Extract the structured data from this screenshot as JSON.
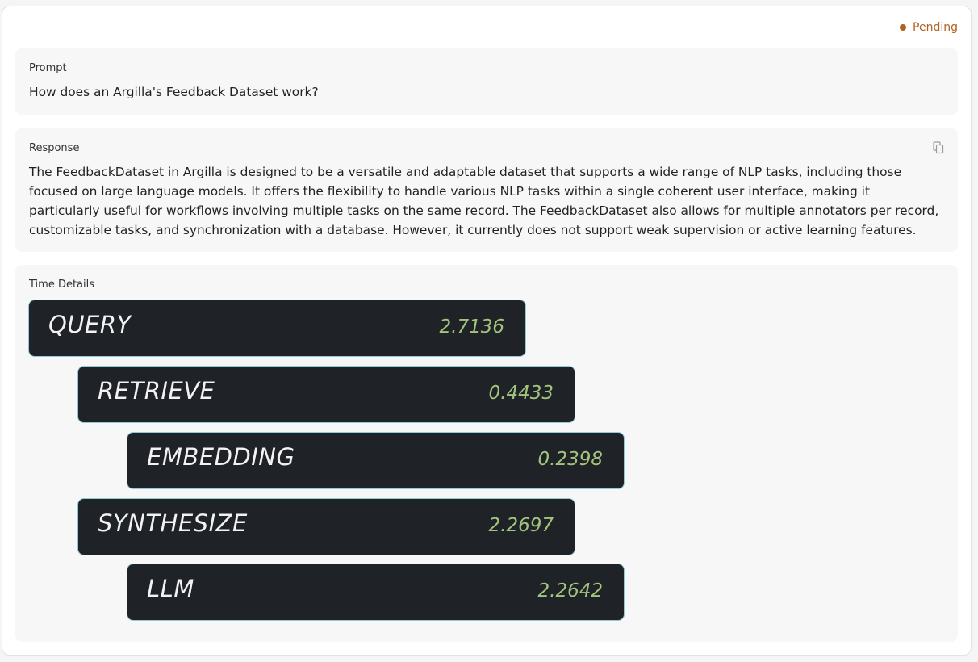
{
  "status": {
    "label": "Pending",
    "color": "#b0621d"
  },
  "prompt": {
    "label": "Prompt",
    "text": "How does an Argilla's Feedback Dataset work?"
  },
  "response": {
    "label": "Response",
    "text": "The FeedbackDataset in Argilla is designed to be a versatile and adaptable dataset that supports a wide range of NLP tasks, including those focused on large language models. It offers the flexibility to handle various NLP tasks within a single coherent user interface, making it particularly useful for workflows involving multiple tasks on the same record. The FeedbackDataset also allows for multiple annotators per record, customizable tasks, and synchronization with a database. However, it currently does not support weak supervision or active learning features.",
    "copy_icon": "copy-icon"
  },
  "time_details": {
    "label": "Time Details",
    "steps": [
      {
        "name": "QUERY",
        "value": "2.7136",
        "depth": 0
      },
      {
        "name": "RETRIEVE",
        "value": "0.4433",
        "depth": 1
      },
      {
        "name": "EMBEDDING",
        "value": "0.2398",
        "depth": 2
      },
      {
        "name": "SYNTHESIZE",
        "value": "2.2697",
        "depth": 1
      },
      {
        "name": "LLM",
        "value": "2.2642",
        "depth": 2
      }
    ]
  },
  "colors": {
    "step_bg": "#1f2227",
    "step_border": "#8fcad6",
    "step_value": "#a3c47e"
  }
}
